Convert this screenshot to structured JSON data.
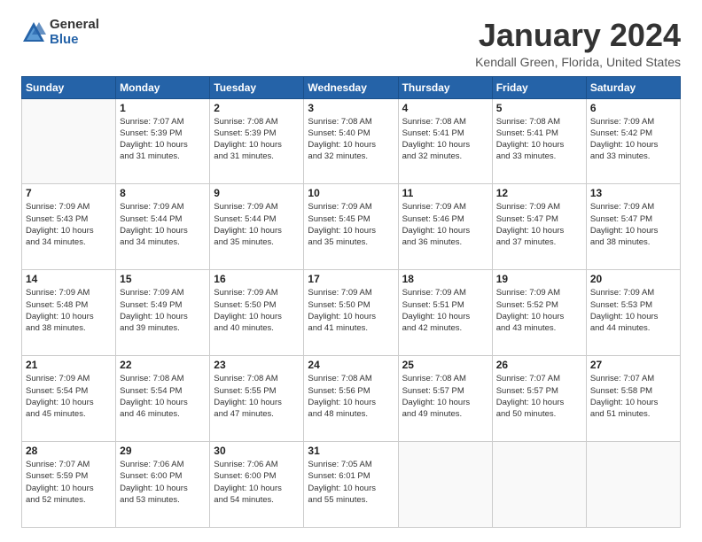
{
  "logo": {
    "general": "General",
    "blue": "Blue"
  },
  "title": {
    "main": "January 2024",
    "sub": "Kendall Green, Florida, United States"
  },
  "days_of_week": [
    "Sunday",
    "Monday",
    "Tuesday",
    "Wednesday",
    "Thursday",
    "Friday",
    "Saturday"
  ],
  "weeks": [
    [
      {
        "day": "",
        "info": ""
      },
      {
        "day": "1",
        "info": "Sunrise: 7:07 AM\nSunset: 5:39 PM\nDaylight: 10 hours\nand 31 minutes."
      },
      {
        "day": "2",
        "info": "Sunrise: 7:08 AM\nSunset: 5:39 PM\nDaylight: 10 hours\nand 31 minutes."
      },
      {
        "day": "3",
        "info": "Sunrise: 7:08 AM\nSunset: 5:40 PM\nDaylight: 10 hours\nand 32 minutes."
      },
      {
        "day": "4",
        "info": "Sunrise: 7:08 AM\nSunset: 5:41 PM\nDaylight: 10 hours\nand 32 minutes."
      },
      {
        "day": "5",
        "info": "Sunrise: 7:08 AM\nSunset: 5:41 PM\nDaylight: 10 hours\nand 33 minutes."
      },
      {
        "day": "6",
        "info": "Sunrise: 7:09 AM\nSunset: 5:42 PM\nDaylight: 10 hours\nand 33 minutes."
      }
    ],
    [
      {
        "day": "7",
        "info": "Sunrise: 7:09 AM\nSunset: 5:43 PM\nDaylight: 10 hours\nand 34 minutes."
      },
      {
        "day": "8",
        "info": "Sunrise: 7:09 AM\nSunset: 5:44 PM\nDaylight: 10 hours\nand 34 minutes."
      },
      {
        "day": "9",
        "info": "Sunrise: 7:09 AM\nSunset: 5:44 PM\nDaylight: 10 hours\nand 35 minutes."
      },
      {
        "day": "10",
        "info": "Sunrise: 7:09 AM\nSunset: 5:45 PM\nDaylight: 10 hours\nand 35 minutes."
      },
      {
        "day": "11",
        "info": "Sunrise: 7:09 AM\nSunset: 5:46 PM\nDaylight: 10 hours\nand 36 minutes."
      },
      {
        "day": "12",
        "info": "Sunrise: 7:09 AM\nSunset: 5:47 PM\nDaylight: 10 hours\nand 37 minutes."
      },
      {
        "day": "13",
        "info": "Sunrise: 7:09 AM\nSunset: 5:47 PM\nDaylight: 10 hours\nand 38 minutes."
      }
    ],
    [
      {
        "day": "14",
        "info": "Sunrise: 7:09 AM\nSunset: 5:48 PM\nDaylight: 10 hours\nand 38 minutes."
      },
      {
        "day": "15",
        "info": "Sunrise: 7:09 AM\nSunset: 5:49 PM\nDaylight: 10 hours\nand 39 minutes."
      },
      {
        "day": "16",
        "info": "Sunrise: 7:09 AM\nSunset: 5:50 PM\nDaylight: 10 hours\nand 40 minutes."
      },
      {
        "day": "17",
        "info": "Sunrise: 7:09 AM\nSunset: 5:50 PM\nDaylight: 10 hours\nand 41 minutes."
      },
      {
        "day": "18",
        "info": "Sunrise: 7:09 AM\nSunset: 5:51 PM\nDaylight: 10 hours\nand 42 minutes."
      },
      {
        "day": "19",
        "info": "Sunrise: 7:09 AM\nSunset: 5:52 PM\nDaylight: 10 hours\nand 43 minutes."
      },
      {
        "day": "20",
        "info": "Sunrise: 7:09 AM\nSunset: 5:53 PM\nDaylight: 10 hours\nand 44 minutes."
      }
    ],
    [
      {
        "day": "21",
        "info": "Sunrise: 7:09 AM\nSunset: 5:54 PM\nDaylight: 10 hours\nand 45 minutes."
      },
      {
        "day": "22",
        "info": "Sunrise: 7:08 AM\nSunset: 5:54 PM\nDaylight: 10 hours\nand 46 minutes."
      },
      {
        "day": "23",
        "info": "Sunrise: 7:08 AM\nSunset: 5:55 PM\nDaylight: 10 hours\nand 47 minutes."
      },
      {
        "day": "24",
        "info": "Sunrise: 7:08 AM\nSunset: 5:56 PM\nDaylight: 10 hours\nand 48 minutes."
      },
      {
        "day": "25",
        "info": "Sunrise: 7:08 AM\nSunset: 5:57 PM\nDaylight: 10 hours\nand 49 minutes."
      },
      {
        "day": "26",
        "info": "Sunrise: 7:07 AM\nSunset: 5:57 PM\nDaylight: 10 hours\nand 50 minutes."
      },
      {
        "day": "27",
        "info": "Sunrise: 7:07 AM\nSunset: 5:58 PM\nDaylight: 10 hours\nand 51 minutes."
      }
    ],
    [
      {
        "day": "28",
        "info": "Sunrise: 7:07 AM\nSunset: 5:59 PM\nDaylight: 10 hours\nand 52 minutes."
      },
      {
        "day": "29",
        "info": "Sunrise: 7:06 AM\nSunset: 6:00 PM\nDaylight: 10 hours\nand 53 minutes."
      },
      {
        "day": "30",
        "info": "Sunrise: 7:06 AM\nSunset: 6:00 PM\nDaylight: 10 hours\nand 54 minutes."
      },
      {
        "day": "31",
        "info": "Sunrise: 7:05 AM\nSunset: 6:01 PM\nDaylight: 10 hours\nand 55 minutes."
      },
      {
        "day": "",
        "info": ""
      },
      {
        "day": "",
        "info": ""
      },
      {
        "day": "",
        "info": ""
      }
    ]
  ]
}
